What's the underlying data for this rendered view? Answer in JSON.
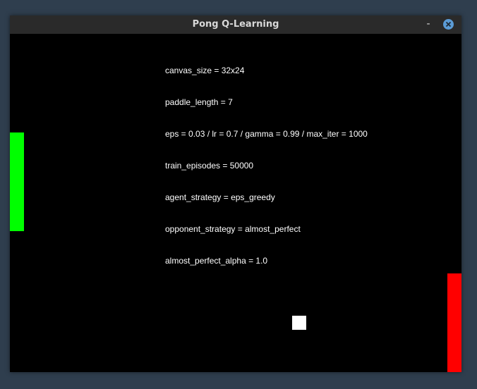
{
  "window": {
    "title": "Pong Q-Learning",
    "minimize_symbol": "-"
  },
  "info_lines": [
    "canvas_size = 32x24",
    "paddle_length = 7",
    "eps = 0.03 / lr = 0.7 / gamma = 0.99 / max_iter = 1000",
    "train_episodes = 50000",
    "agent_strategy = eps_greedy",
    "opponent_strategy = almost_perfect",
    "almost_perfect_alpha = 1.0"
  ],
  "colors": {
    "agent_paddle": "#00ff00",
    "opponent_paddle": "#ff0000",
    "ball": "#ffffff",
    "background": "#000000",
    "close_button": "#5b9bd5"
  },
  "icons": {
    "minimize": "minimize-icon",
    "close": "close-icon"
  }
}
